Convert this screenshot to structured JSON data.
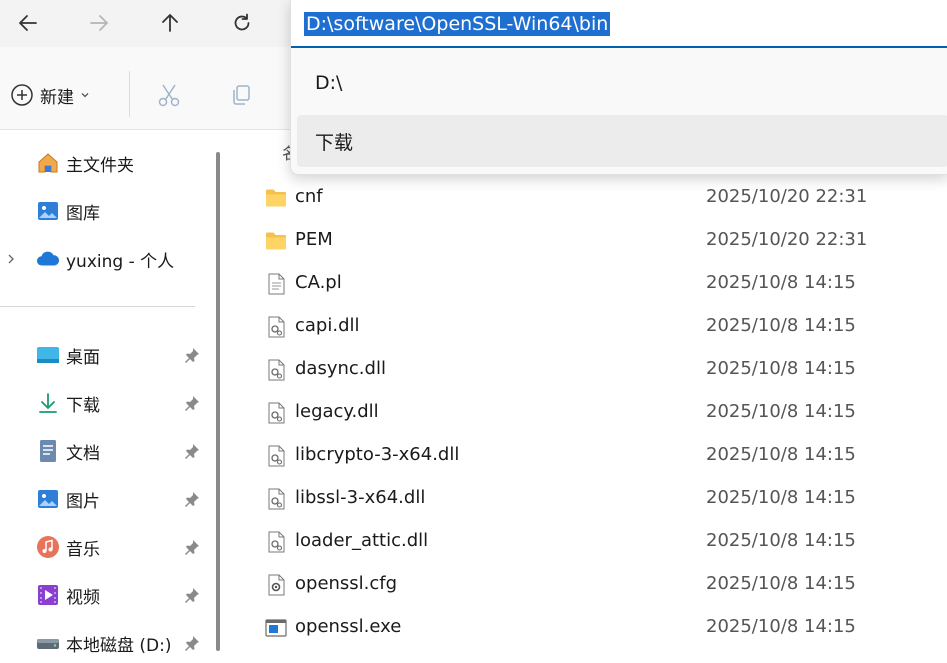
{
  "nav": {
    "back_icon": "arrow-left-icon",
    "forward_icon": "arrow-right-icon",
    "up_icon": "arrow-up-icon",
    "refresh_icon": "refresh-icon"
  },
  "address_bar": {
    "value": "D:\\software\\OpenSSL-Win64\\bin",
    "suggestions": [
      "D:\\",
      "下载"
    ]
  },
  "toolbar": {
    "new_label": "新建"
  },
  "sidebar": {
    "home": "主文件夹",
    "gallery": "图库",
    "onedrive": "yuxing - 个人",
    "quick": [
      {
        "label": "桌面",
        "icon": "desktop-icon"
      },
      {
        "label": "下载",
        "icon": "download-icon"
      },
      {
        "label": "文档",
        "icon": "document-icon"
      },
      {
        "label": "图片",
        "icon": "pictures-icon"
      },
      {
        "label": "音乐",
        "icon": "music-icon"
      },
      {
        "label": "视频",
        "icon": "video-icon"
      },
      {
        "label": "本地磁盘 (D:)",
        "icon": "drive-icon"
      }
    ]
  },
  "content": {
    "header_peek": "名",
    "files": [
      {
        "name": "cnf",
        "date": "2025/10/20 22:31",
        "icon": "folder-icon"
      },
      {
        "name": "PEM",
        "date": "2025/10/20 22:31",
        "icon": "folder-icon"
      },
      {
        "name": "CA.pl",
        "date": "2025/10/8 14:15",
        "icon": "text-file-icon"
      },
      {
        "name": "capi.dll",
        "date": "2025/10/8 14:15",
        "icon": "dll-file-icon"
      },
      {
        "name": "dasync.dll",
        "date": "2025/10/8 14:15",
        "icon": "dll-file-icon"
      },
      {
        "name": "legacy.dll",
        "date": "2025/10/8 14:15",
        "icon": "dll-file-icon"
      },
      {
        "name": "libcrypto-3-x64.dll",
        "date": "2025/10/8 14:15",
        "icon": "dll-file-icon"
      },
      {
        "name": "libssl-3-x64.dll",
        "date": "2025/10/8 14:15",
        "icon": "dll-file-icon"
      },
      {
        "name": "loader_attic.dll",
        "date": "2025/10/8 14:15",
        "icon": "dll-file-icon"
      },
      {
        "name": "openssl.cfg",
        "date": "2025/10/8 14:15",
        "icon": "config-file-icon"
      },
      {
        "name": "openssl.exe",
        "date": "2025/10/8 14:15",
        "icon": "exe-file-icon"
      }
    ]
  },
  "colors": {
    "accent": "#0063b1",
    "selection": "#1f6fd0",
    "folder": "#f4c04e"
  }
}
